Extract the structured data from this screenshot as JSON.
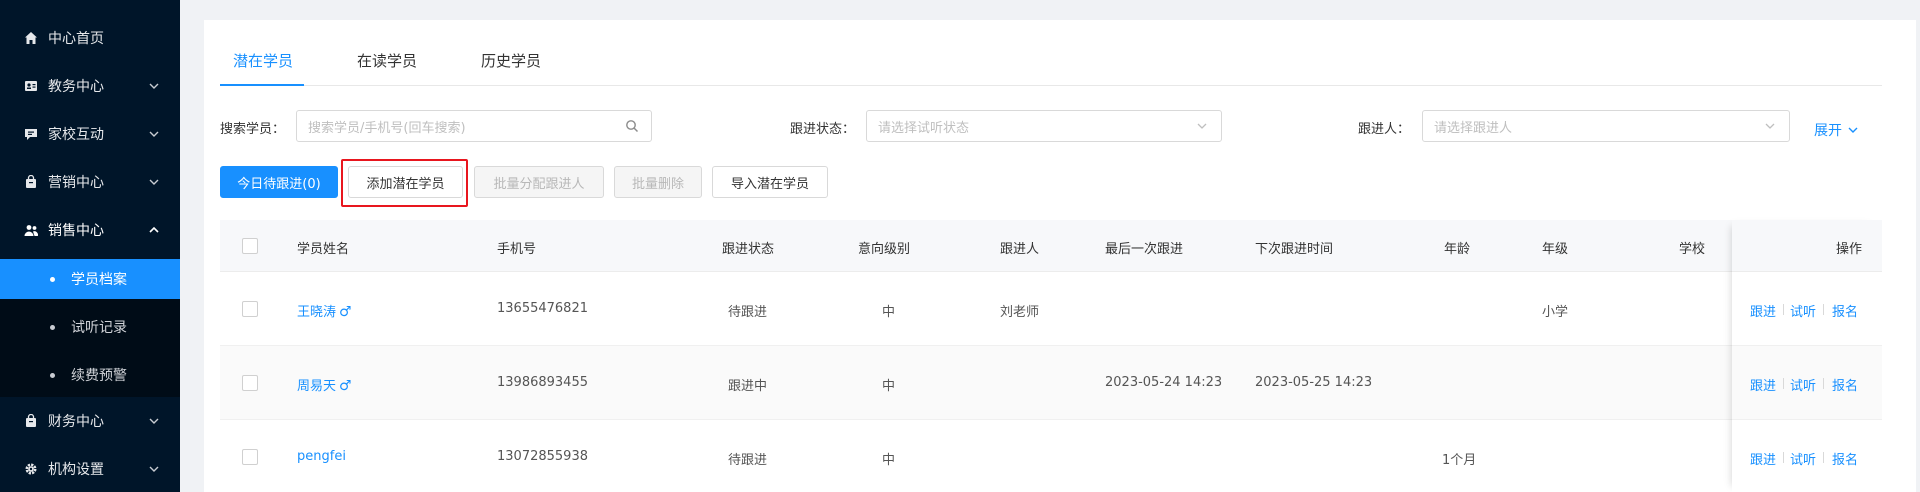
{
  "sidebar": {
    "items": [
      {
        "label": "中心首页",
        "icon": "home-icon",
        "has_arrow": false
      },
      {
        "label": "教务中心",
        "icon": "person-card-icon",
        "has_arrow": true
      },
      {
        "label": "家校互动",
        "icon": "chat-book-icon",
        "has_arrow": true
      },
      {
        "label": "营销中心",
        "icon": "shopping-bag-icon",
        "has_arrow": true
      },
      {
        "label": "销售中心",
        "icon": "users-icon",
        "has_arrow": true,
        "open": true
      },
      {
        "label": "财务中心",
        "icon": "wallet-icon",
        "has_arrow": true
      },
      {
        "label": "机构设置",
        "icon": "gear-icon",
        "has_arrow": true
      }
    ],
    "subitems": [
      {
        "label": "学员档案",
        "active": true
      },
      {
        "label": "试听记录",
        "active": false
      },
      {
        "label": "续费预警",
        "active": false
      }
    ]
  },
  "tabs": [
    {
      "label": "潜在学员",
      "active": true
    },
    {
      "label": "在读学员",
      "active": false
    },
    {
      "label": "历史学员",
      "active": false
    }
  ],
  "filters": {
    "search_label": "搜索学员：",
    "search_placeholder": "搜索学员/手机号(回车搜索)",
    "status_label": "跟进状态：",
    "status_placeholder": "请选择试听状态",
    "follower_label": "跟进人：",
    "follower_placeholder": "请选择跟进人",
    "expand_label": "展开"
  },
  "buttons": {
    "today_follow": "今日待跟进(0)",
    "add_potential": "添加潜在学员",
    "batch_assign": "批量分配跟进人",
    "batch_delete": "批量删除",
    "import_potential": "导入潜在学员"
  },
  "table": {
    "headers": {
      "name": "学员姓名",
      "phone": "手机号",
      "status": "跟进状态",
      "intent": "意向级别",
      "follower": "跟进人",
      "last_follow": "最后一次跟进",
      "next_follow": "下次跟进时间",
      "age": "年龄",
      "grade": "年级",
      "school": "学校",
      "actions": "操作"
    },
    "rows": [
      {
        "name": "王晓涛",
        "gender": "♂",
        "phone": "13655476821",
        "status": "待跟进",
        "intent": "中",
        "follower": "刘老师",
        "last_follow": "",
        "next_follow": "",
        "age": "",
        "grade": "小学",
        "school": ""
      },
      {
        "name": "周易天",
        "gender": "♂",
        "phone": "13986893455",
        "status": "跟进中",
        "intent": "中",
        "follower": "",
        "last_follow": "2023-05-24 14:23",
        "next_follow": "2023-05-25 14:23",
        "age": "",
        "grade": "",
        "school": ""
      },
      {
        "name": "pengfei",
        "gender": "",
        "phone": "13072855938",
        "status": "待跟进",
        "intent": "中",
        "follower": "",
        "last_follow": "",
        "next_follow": "",
        "age": "1个月",
        "grade": "",
        "school": ""
      }
    ],
    "row_actions": {
      "follow": "跟进",
      "trial": "试听",
      "enroll": "报名"
    }
  },
  "colors": {
    "accent": "#1890ff",
    "sidebar_bg": "#001529",
    "highlight": "#e8161e"
  }
}
